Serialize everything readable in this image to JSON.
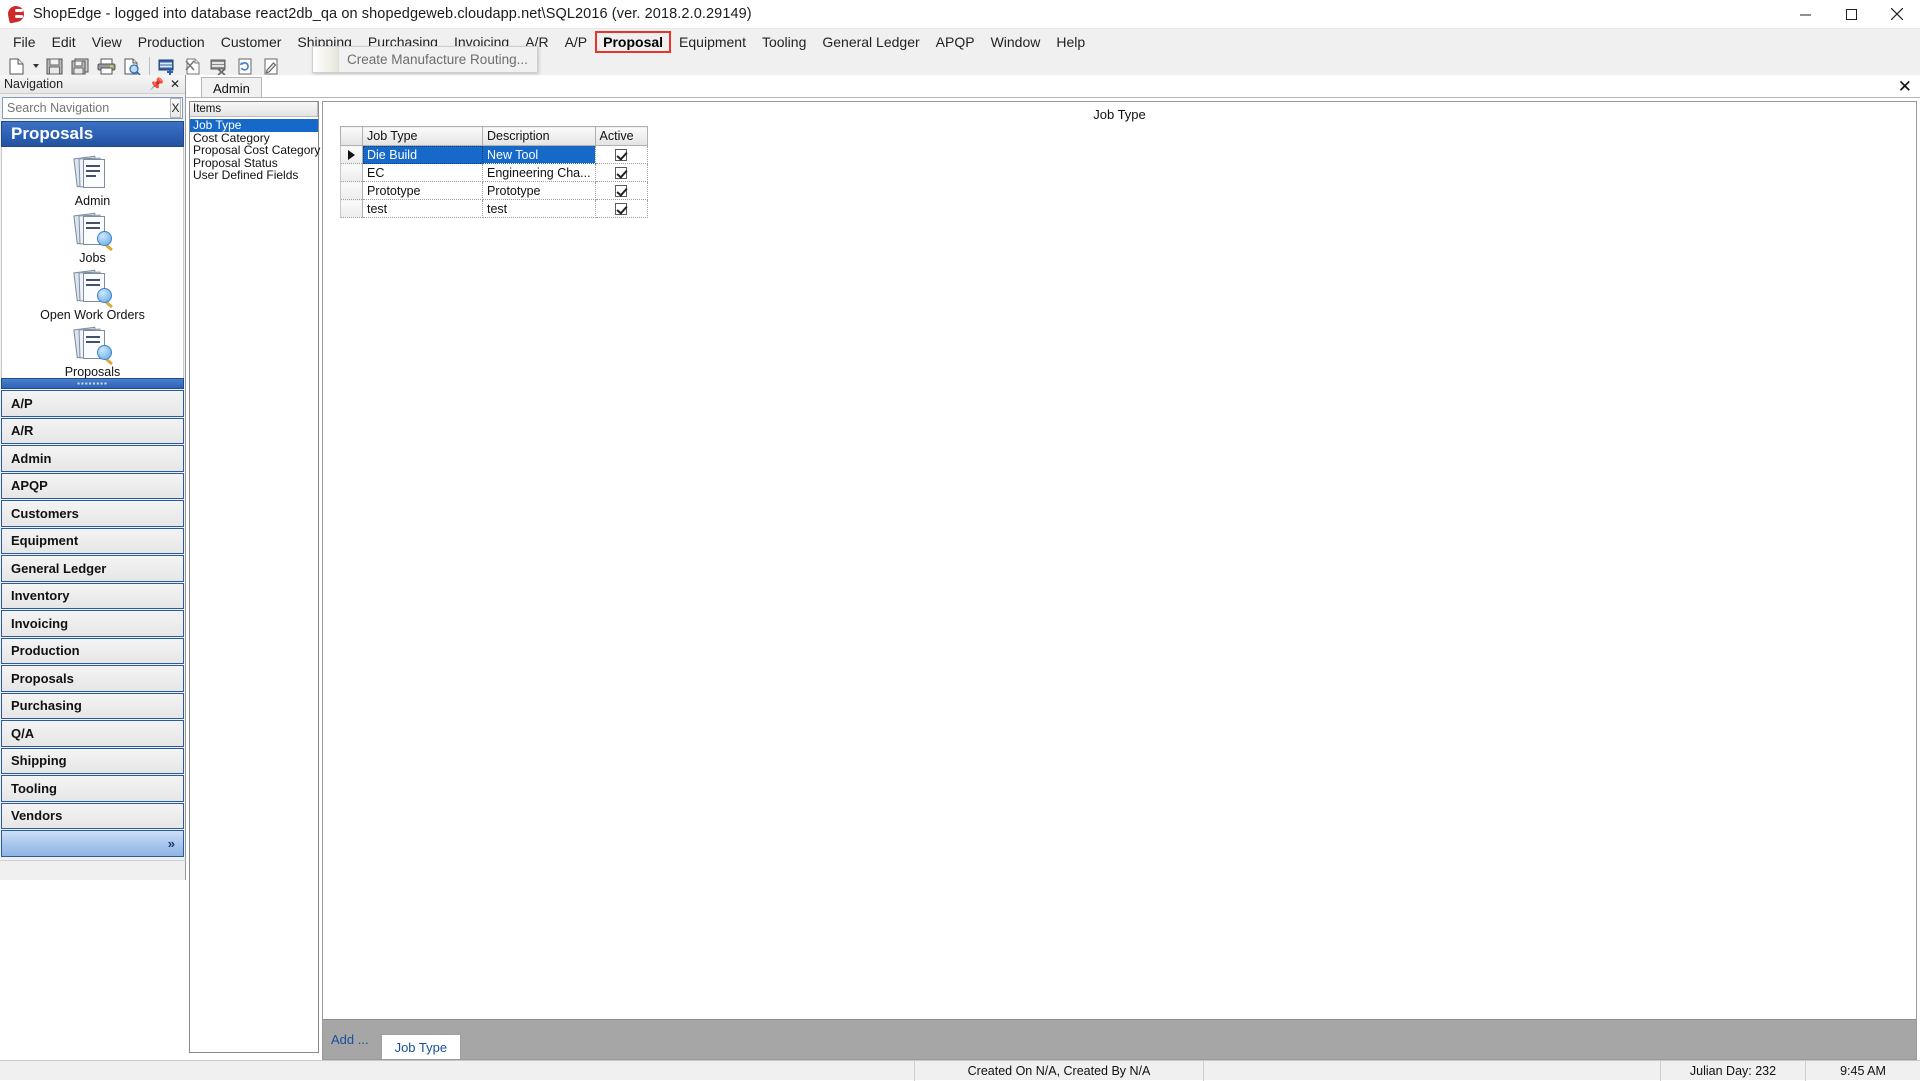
{
  "window": {
    "title": "ShopEdge -  logged into database react2db_qa on shopedgeweb.cloudapp.net\\SQL2016 (ver. 2018.2.0.29149)",
    "app_icon": "shopedge-logo-icon",
    "minimize_label": "Minimize",
    "maximize_label": "Maximize",
    "close_label": "Close"
  },
  "menubar": {
    "items": [
      {
        "label": "File",
        "highlighted": false
      },
      {
        "label": "Edit",
        "highlighted": false
      },
      {
        "label": "View",
        "highlighted": false
      },
      {
        "label": "Production",
        "highlighted": false
      },
      {
        "label": "Customer",
        "highlighted": false
      },
      {
        "label": "Shipping",
        "highlighted": false
      },
      {
        "label": "Purchasing",
        "highlighted": false
      },
      {
        "label": "Invoicing",
        "highlighted": false
      },
      {
        "label": "A/R",
        "highlighted": false
      },
      {
        "label": "A/P",
        "highlighted": false
      },
      {
        "label": "Proposal",
        "highlighted": true
      },
      {
        "label": "Equipment",
        "highlighted": false
      },
      {
        "label": "Tooling",
        "highlighted": false
      },
      {
        "label": "General Ledger",
        "highlighted": false
      },
      {
        "label": "APQP",
        "highlighted": false
      },
      {
        "label": "Window",
        "highlighted": false
      },
      {
        "label": "Help",
        "highlighted": false
      }
    ]
  },
  "dropdown": {
    "parent": "Proposal",
    "items": [
      {
        "label": "Create Manufacture Routing...",
        "enabled": false
      }
    ]
  },
  "toolbar": {
    "buttons": [
      {
        "name": "new-document-icon",
        "glyph": "page"
      },
      {
        "name": "new-dropdown-caret-icon",
        "glyph": "caret"
      },
      {
        "name": "save-icon",
        "glyph": "floppy"
      },
      {
        "name": "save-all-icon",
        "glyph": "floppy-stack"
      },
      {
        "name": "print-icon",
        "glyph": "printer"
      },
      {
        "name": "print-preview-icon",
        "glyph": "page-magnifier"
      },
      {
        "name": "add-record-icon",
        "glyph": "grid-plus"
      },
      {
        "name": "delete-record-icon",
        "glyph": "page-x"
      },
      {
        "name": "filter-remove-icon",
        "glyph": "grid-x"
      },
      {
        "name": "refresh-icon",
        "glyph": "page-refresh"
      },
      {
        "name": "edit-icon",
        "glyph": "page-pencil"
      }
    ]
  },
  "navigation": {
    "header_title": "Navigation",
    "pin_icon": "pin-icon",
    "close_icon": "close-icon",
    "search": {
      "value": "",
      "placeholder": "Search Navigation",
      "clear_label": "X"
    },
    "group_title": "Proposals",
    "shortcuts": [
      {
        "label": "Admin",
        "icon": "proposal-doc-icon"
      },
      {
        "label": "Jobs",
        "icon": "proposal-doc-search-icon"
      },
      {
        "label": "Open Work Orders",
        "icon": "proposal-doc-search-icon"
      },
      {
        "label": "Proposals",
        "icon": "proposal-doc-search-icon"
      }
    ],
    "splitter_dots": "▪▪▪▪▪▪▪▪",
    "modules": [
      "A/P",
      "A/R",
      "Admin",
      "APQP",
      "Customers",
      "Equipment",
      "General Ledger",
      "Inventory",
      "Invoicing",
      "Production",
      "Proposals",
      "Purchasing",
      "Q/A",
      "Shipping",
      "Tooling",
      "Vendors"
    ],
    "expand_label": "»"
  },
  "mdi": {
    "tab_label": "Admin",
    "close_label": "✕"
  },
  "items_panel": {
    "header": "Items",
    "items": [
      {
        "label": "Job Type",
        "selected": true
      },
      {
        "label": "Cost Category",
        "selected": false
      },
      {
        "label": "Proposal Cost Category",
        "selected": false
      },
      {
        "label": "Proposal Status",
        "selected": false
      },
      {
        "label": "User Defined Fields",
        "selected": false
      }
    ]
  },
  "detail": {
    "title": "Job Type",
    "grid": {
      "columns": [
        "Job Type",
        "Description",
        "Active"
      ],
      "rows": [
        {
          "indicator": "▶",
          "job_type": "Die Build",
          "description": "New Tool",
          "active": true,
          "selected": true
        },
        {
          "indicator": "",
          "job_type": "EC",
          "description": "Engineering  Cha...",
          "active": true,
          "selected": false
        },
        {
          "indicator": "",
          "job_type": "Prototype",
          "description": "Prototype",
          "active": true,
          "selected": false
        },
        {
          "indicator": "",
          "job_type": "test",
          "description": "test",
          "active": true,
          "selected": false
        }
      ]
    },
    "footer": {
      "add_label": "Add ...",
      "tab_label": "Job Type"
    }
  },
  "statusbar": {
    "left": "",
    "created": "Created On N/A, Created By N/A",
    "middle": "",
    "julian": "Julian Day: 232",
    "time": "9:45 AM"
  },
  "colors": {
    "accent_blue": "#1669c8",
    "nav_title_blue": "#2d62b6",
    "highlight_red": "#e8342a",
    "footer_gray": "#a6a6a6"
  }
}
